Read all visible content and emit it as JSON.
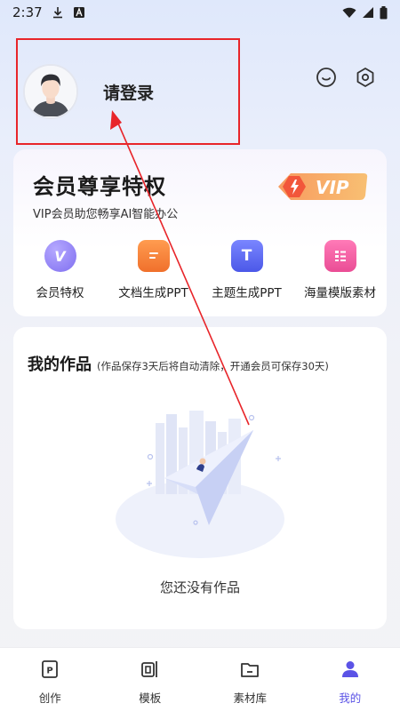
{
  "status_bar": {
    "time": "2:37",
    "icons": [
      "download-icon",
      "a-icon",
      "wifi-icon",
      "signal-icon",
      "battery-icon"
    ]
  },
  "profile": {
    "login_label": "请登录",
    "avatar_icon": "avatar-person",
    "actions": [
      "smiley-icon",
      "settings-hexagon-icon"
    ]
  },
  "vip_card": {
    "title": "会员尊享特权",
    "subtitle": "VIP会员助您畅享AI智能办公",
    "badge_text": "VIP",
    "features": [
      {
        "label": "会员特权",
        "icon": "v-icon",
        "color": "#8b7cf3"
      },
      {
        "label": "文档生成PPT",
        "icon": "document-icon",
        "color": "#f48a3c"
      },
      {
        "label": "主题生成PPT",
        "icon": "t-icon",
        "color": "#5f6cf0"
      },
      {
        "label": "海量模版素材",
        "icon": "template-list-icon",
        "color": "#ee5fa7"
      }
    ],
    "feature_icon_glyphs": {
      "v": "V",
      "t": "T"
    }
  },
  "works": {
    "title": "我的作品",
    "note": "(作品保存3天后将自动清除，开通会员可保存30天)",
    "empty_text": "您还没有作品"
  },
  "bottom_nav": {
    "items": [
      {
        "label": "创作",
        "icon": "p-square-icon",
        "active": false
      },
      {
        "label": "模板",
        "icon": "template-icon",
        "active": false
      },
      {
        "label": "素材库",
        "icon": "folder-icon",
        "active": false
      },
      {
        "label": "我的",
        "icon": "person-icon",
        "active": true
      }
    ],
    "create_glyph": "P"
  },
  "colors": {
    "accent": "#5b53e6",
    "highlight": "#e8252a",
    "vip_badge": "#f4623a"
  }
}
